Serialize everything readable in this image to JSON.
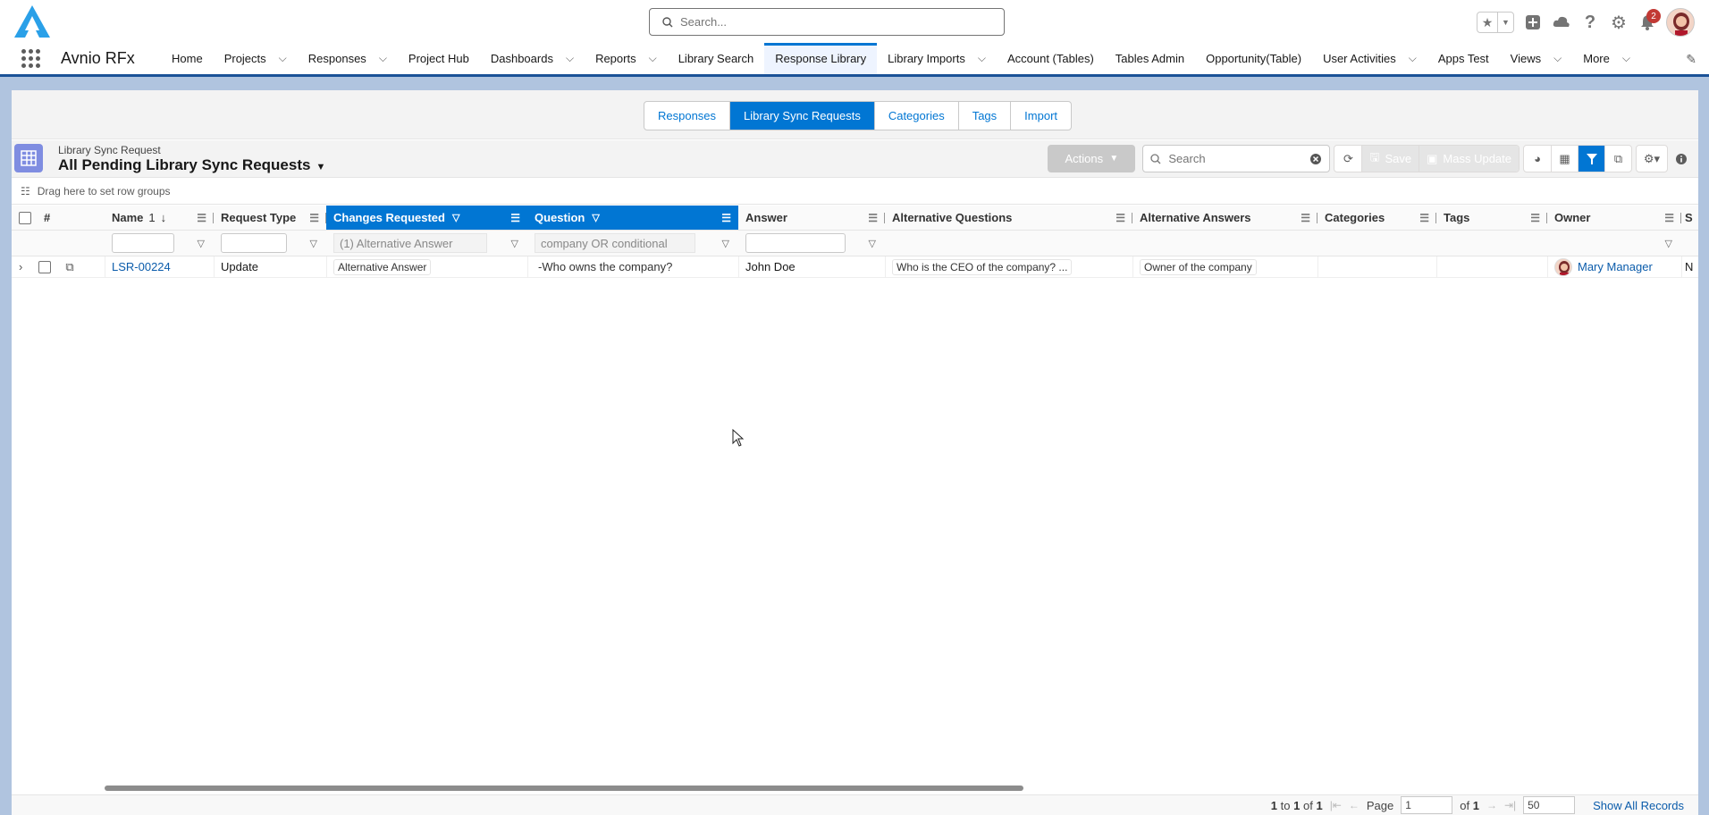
{
  "header": {
    "search_placeholder": "Search...",
    "notification_count": "2"
  },
  "nav": {
    "app_name": "Avnio RFx",
    "items": [
      {
        "label": "Home",
        "dropdown": false,
        "active": false
      },
      {
        "label": "Projects",
        "dropdown": true,
        "active": false
      },
      {
        "label": "Responses",
        "dropdown": true,
        "active": false
      },
      {
        "label": "Project Hub",
        "dropdown": false,
        "active": false
      },
      {
        "label": "Dashboards",
        "dropdown": true,
        "active": false
      },
      {
        "label": "Reports",
        "dropdown": true,
        "active": false
      },
      {
        "label": "Library Search",
        "dropdown": false,
        "active": false
      },
      {
        "label": "Response Library",
        "dropdown": false,
        "active": true
      },
      {
        "label": "Library Imports",
        "dropdown": true,
        "active": false
      },
      {
        "label": "Account (Tables)",
        "dropdown": false,
        "active": false
      },
      {
        "label": "Tables Admin",
        "dropdown": false,
        "active": false
      },
      {
        "label": "Opportunity(Table)",
        "dropdown": false,
        "active": false
      },
      {
        "label": "User Activities",
        "dropdown": true,
        "active": false
      },
      {
        "label": "Apps Test",
        "dropdown": false,
        "active": false
      },
      {
        "label": "Views",
        "dropdown": true,
        "active": false
      },
      {
        "label": "More",
        "dropdown": true,
        "active": false
      }
    ]
  },
  "subtabs": [
    "Responses",
    "Library Sync Requests",
    "Categories",
    "Tags",
    "Import"
  ],
  "subtab_active": "Library Sync Requests",
  "list": {
    "object_label": "Library Sync Request",
    "title": "All Pending Library Sync Requests",
    "actions_label": "Actions",
    "search_placeholder": "Search",
    "save_label": "Save",
    "mass_update_label": "Mass Update",
    "row_group_hint": "Drag here to set row groups"
  },
  "grid": {
    "columns": [
      {
        "key": "num",
        "label": "#"
      },
      {
        "key": "name",
        "label": "Name",
        "sort_order": "1"
      },
      {
        "key": "type",
        "label": "Request Type"
      },
      {
        "key": "changes",
        "label": "Changes Requested"
      },
      {
        "key": "question",
        "label": "Question"
      },
      {
        "key": "answer",
        "label": "Answer"
      },
      {
        "key": "altq",
        "label": "Alternative Questions"
      },
      {
        "key": "alta",
        "label": "Alternative Answers"
      },
      {
        "key": "cats",
        "label": "Categories"
      },
      {
        "key": "tags",
        "label": "Tags"
      },
      {
        "key": "owner",
        "label": "Owner"
      },
      {
        "key": "extra",
        "label": "S"
      }
    ],
    "filters": {
      "changes": "(1) Alternative Answer",
      "question": "company OR conditional"
    },
    "rows": [
      {
        "name": "LSR-00224",
        "type": "Update",
        "changes": "Alternative Answer",
        "question": "-Who owns the company?",
        "answer": "John Doe",
        "altq": "Who is the CEO of the company? ...",
        "alta": "Owner of the company",
        "cats": "",
        "tags": "",
        "owner": "Mary Manager",
        "extra": "N"
      }
    ]
  },
  "footer": {
    "range_start": "1",
    "range_to": "to",
    "range_end": "1",
    "range_of": "of",
    "total": "1",
    "page_label": "Page",
    "page_value": "1",
    "of_label": "of",
    "page_total": "1",
    "page_size": "50",
    "show_all": "Show All Records"
  },
  "colors": {
    "brand_blue": "#0176d3",
    "nav_border": "#1b5297",
    "obj_icon": "#7f8de1"
  }
}
